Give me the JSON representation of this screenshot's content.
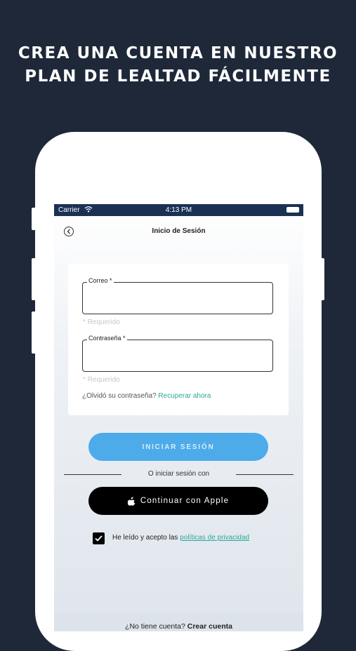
{
  "headline": {
    "line1": "CREA UNA CUENTA EN NUESTRO",
    "line2": "PLAN DE LEALTAD FÁCILMENTE"
  },
  "status_bar": {
    "carrier": "Carrier",
    "time": "4:13 PM"
  },
  "nav": {
    "title": "Inicio de Sesión",
    "back_icon": "chevron-left-circle-icon"
  },
  "form": {
    "email_label": "Correo *",
    "email_value": "",
    "email_helper": "* Requerido",
    "password_label": "Contraseña *",
    "password_value": "",
    "password_helper": "* Requerido",
    "forgot_text": "¿Olvidó su contraseña?",
    "forgot_link": "Recuperar ahora"
  },
  "buttons": {
    "login": "INICIAR SESIÓN",
    "alt_login_text": "O iniciar sesión con",
    "apple": "Continuar con Apple"
  },
  "terms": {
    "checked": true,
    "text": "He leído y acepto las",
    "link": "políticas de privacidad"
  },
  "footer": {
    "question": "¿No tiene cuenta?",
    "create": "Crear cuenta"
  },
  "colors": {
    "background": "#1e2839",
    "status_bar": "#1b3154",
    "primary_button": "#4dabea",
    "link": "#2aa79b"
  }
}
